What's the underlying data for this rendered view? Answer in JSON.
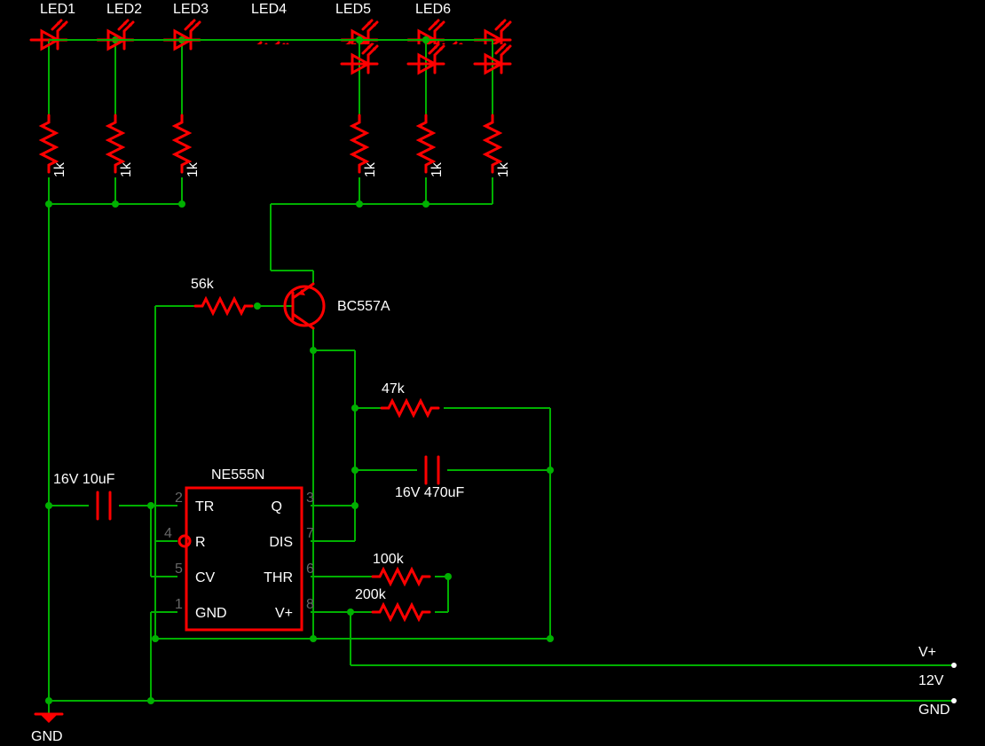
{
  "leds": [
    {
      "ref": "LED1"
    },
    {
      "ref": "LED2"
    },
    {
      "ref": "LED3"
    },
    {
      "ref": "LED4"
    },
    {
      "ref": "LED5"
    },
    {
      "ref": "LED6"
    }
  ],
  "res_led": [
    {
      "value": "1k"
    },
    {
      "value": "1k"
    },
    {
      "value": "1k"
    },
    {
      "value": "1k"
    },
    {
      "value": "1k"
    },
    {
      "value": "1k"
    }
  ],
  "r_base": {
    "value": "56k"
  },
  "transistor": {
    "value": "BC557A"
  },
  "r_feedback": {
    "value": "47k"
  },
  "c_feedback": {
    "value": "16V 470uF"
  },
  "c_timing": {
    "value": "16V 10uF"
  },
  "ic": {
    "value": "NE555N",
    "pins": {
      "p1": {
        "num": "1",
        "name": "GND"
      },
      "p2": {
        "num": "2",
        "name": "TR"
      },
      "p3": {
        "num": "3",
        "name": "Q"
      },
      "p4": {
        "num": "4",
        "name": "R"
      },
      "p5": {
        "num": "5",
        "name": "CV"
      },
      "p6": {
        "num": "6",
        "name": "THR"
      },
      "p7": {
        "num": "7",
        "name": "DIS"
      },
      "p8": {
        "num": "8",
        "name": "V+"
      }
    }
  },
  "r_100k": {
    "value": "100k"
  },
  "r_200k": {
    "value": "200k"
  },
  "supply": {
    "vplus": "V+",
    "voltage": "12V",
    "gnd": "GND"
  },
  "gnd_sym": {
    "label": "GND"
  }
}
